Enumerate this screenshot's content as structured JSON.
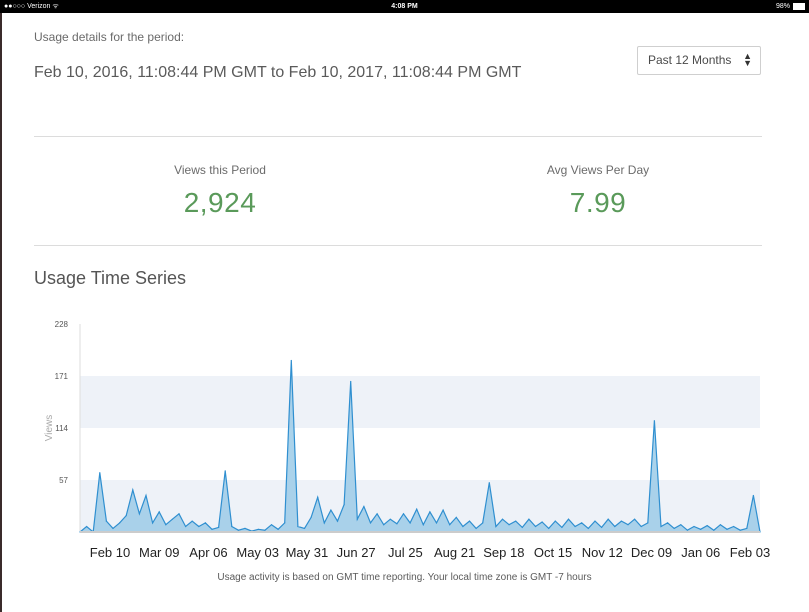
{
  "status_bar": {
    "carrier": "●●○○○ Verizon ᯤ",
    "time": "4:08 PM",
    "battery": "98%"
  },
  "period": {
    "label": "Usage details for the period:",
    "range": "Feb 10, 2016, 11:08:44 PM GMT to Feb 10, 2017, 11:08:44 PM GMT",
    "selected_option": "Past 12 Months"
  },
  "stats": [
    {
      "label": "Views this Period",
      "value": "2,924"
    },
    {
      "label": "Avg Views Per Day",
      "value": "7.99"
    }
  ],
  "section_title": "Usage Time Series",
  "footnote": "Usage activity is based on GMT time reporting. Your local time zone is GMT -7 hours",
  "colors": {
    "line": "#2f8fd0",
    "fill": "#9ccbe8",
    "band": "#eef2f8",
    "value_green": "#5a9a5a"
  },
  "chart_data": {
    "type": "area",
    "xlabel": "",
    "ylabel": "Views",
    "ylim": [
      0,
      228
    ],
    "yticks": [
      57,
      114,
      171,
      228
    ],
    "grid": true,
    "xtick_labels": [
      "Feb 10",
      "Mar 09",
      "Apr 06",
      "May 03",
      "May 31",
      "Jun 27",
      "Jul 25",
      "Aug 21",
      "Sep 18",
      "Oct 15",
      "Nov 12",
      "Dec 09",
      "Jan 06",
      "Feb 03"
    ],
    "points": [
      {
        "x": "Feb 10",
        "y": 0
      },
      {
        "x": "Feb 14",
        "y": 6
      },
      {
        "x": "Feb 18",
        "y": 0
      },
      {
        "x": "Feb 23",
        "y": 65
      },
      {
        "x": "Feb 26",
        "y": 12
      },
      {
        "x": "Mar 02",
        "y": 4
      },
      {
        "x": "Mar 05",
        "y": 10
      },
      {
        "x": "Mar 07",
        "y": 18
      },
      {
        "x": "Mar 10",
        "y": 46
      },
      {
        "x": "Mar 12",
        "y": 20
      },
      {
        "x": "Mar 14",
        "y": 40
      },
      {
        "x": "Mar 17",
        "y": 10
      },
      {
        "x": "Mar 20",
        "y": 22
      },
      {
        "x": "Mar 22",
        "y": 8
      },
      {
        "x": "Mar 26",
        "y": 14
      },
      {
        "x": "Mar 29",
        "y": 20
      },
      {
        "x": "Apr 02",
        "y": 6
      },
      {
        "x": "Apr 06",
        "y": 12
      },
      {
        "x": "Apr 09",
        "y": 6
      },
      {
        "x": "Apr 13",
        "y": 10
      },
      {
        "x": "Apr 16",
        "y": 3
      },
      {
        "x": "Apr 19",
        "y": 5
      },
      {
        "x": "Apr 22",
        "y": 67
      },
      {
        "x": "Apr 25",
        "y": 6
      },
      {
        "x": "Apr 29",
        "y": 2
      },
      {
        "x": "May 03",
        "y": 4
      },
      {
        "x": "May 07",
        "y": 1
      },
      {
        "x": "May 11",
        "y": 3
      },
      {
        "x": "May 15",
        "y": 2
      },
      {
        "x": "May 19",
        "y": 8
      },
      {
        "x": "May 23",
        "y": 3
      },
      {
        "x": "May 28",
        "y": 10
      },
      {
        "x": "May 31",
        "y": 188
      },
      {
        "x": "Jun 03",
        "y": 6
      },
      {
        "x": "Jun 07",
        "y": 4
      },
      {
        "x": "Jun 11",
        "y": 16
      },
      {
        "x": "Jun 14",
        "y": 38
      },
      {
        "x": "Jun 17",
        "y": 10
      },
      {
        "x": "Jun 19",
        "y": 24
      },
      {
        "x": "Jun 22",
        "y": 12
      },
      {
        "x": "Jun 25",
        "y": 30
      },
      {
        "x": "Jun 27",
        "y": 165
      },
      {
        "x": "Jun 30",
        "y": 14
      },
      {
        "x": "Jul 03",
        "y": 28
      },
      {
        "x": "Jul 06",
        "y": 10
      },
      {
        "x": "Jul 09",
        "y": 20
      },
      {
        "x": "Jul 12",
        "y": 8
      },
      {
        "x": "Jul 15",
        "y": 14
      },
      {
        "x": "Jul 18",
        "y": 9
      },
      {
        "x": "Jul 22",
        "y": 20
      },
      {
        "x": "Jul 25",
        "y": 10
      },
      {
        "x": "Jul 28",
        "y": 25
      },
      {
        "x": "Jul 31",
        "y": 8
      },
      {
        "x": "Aug 04",
        "y": 22
      },
      {
        "x": "Aug 07",
        "y": 10
      },
      {
        "x": "Aug 11",
        "y": 24
      },
      {
        "x": "Aug 14",
        "y": 8
      },
      {
        "x": "Aug 18",
        "y": 16
      },
      {
        "x": "Aug 21",
        "y": 6
      },
      {
        "x": "Aug 24",
        "y": 12
      },
      {
        "x": "Aug 28",
        "y": 4
      },
      {
        "x": "Aug 31",
        "y": 10
      },
      {
        "x": "Sep 03",
        "y": 54
      },
      {
        "x": "Sep 06",
        "y": 6
      },
      {
        "x": "Sep 10",
        "y": 14
      },
      {
        "x": "Sep 14",
        "y": 8
      },
      {
        "x": "Sep 18",
        "y": 12
      },
      {
        "x": "Sep 22",
        "y": 5
      },
      {
        "x": "Sep 26",
        "y": 14
      },
      {
        "x": "Sep 30",
        "y": 6
      },
      {
        "x": "Oct 04",
        "y": 11
      },
      {
        "x": "Oct 08",
        "y": 4
      },
      {
        "x": "Oct 12",
        "y": 12
      },
      {
        "x": "Oct 15",
        "y": 5
      },
      {
        "x": "Oct 19",
        "y": 14
      },
      {
        "x": "Oct 23",
        "y": 6
      },
      {
        "x": "Oct 27",
        "y": 10
      },
      {
        "x": "Oct 31",
        "y": 4
      },
      {
        "x": "Nov 04",
        "y": 12
      },
      {
        "x": "Nov 08",
        "y": 5
      },
      {
        "x": "Nov 12",
        "y": 14
      },
      {
        "x": "Nov 16",
        "y": 6
      },
      {
        "x": "Nov 20",
        "y": 12
      },
      {
        "x": "Nov 24",
        "y": 8
      },
      {
        "x": "Nov 28",
        "y": 14
      },
      {
        "x": "Dec 02",
        "y": 6
      },
      {
        "x": "Dec 06",
        "y": 10
      },
      {
        "x": "Dec 09",
        "y": 122
      },
      {
        "x": "Dec 12",
        "y": 6
      },
      {
        "x": "Dec 16",
        "y": 10
      },
      {
        "x": "Dec 20",
        "y": 4
      },
      {
        "x": "Dec 24",
        "y": 8
      },
      {
        "x": "Dec 28",
        "y": 2
      },
      {
        "x": "Jan 01",
        "y": 6
      },
      {
        "x": "Jan 06",
        "y": 3
      },
      {
        "x": "Jan 10",
        "y": 7
      },
      {
        "x": "Jan 14",
        "y": 2
      },
      {
        "x": "Jan 18",
        "y": 8
      },
      {
        "x": "Jan 22",
        "y": 3
      },
      {
        "x": "Jan 26",
        "y": 6
      },
      {
        "x": "Jan 30",
        "y": 2
      },
      {
        "x": "Feb 03",
        "y": 4
      },
      {
        "x": "Feb 07",
        "y": 40
      },
      {
        "x": "Feb 10",
        "y": 0
      }
    ]
  }
}
